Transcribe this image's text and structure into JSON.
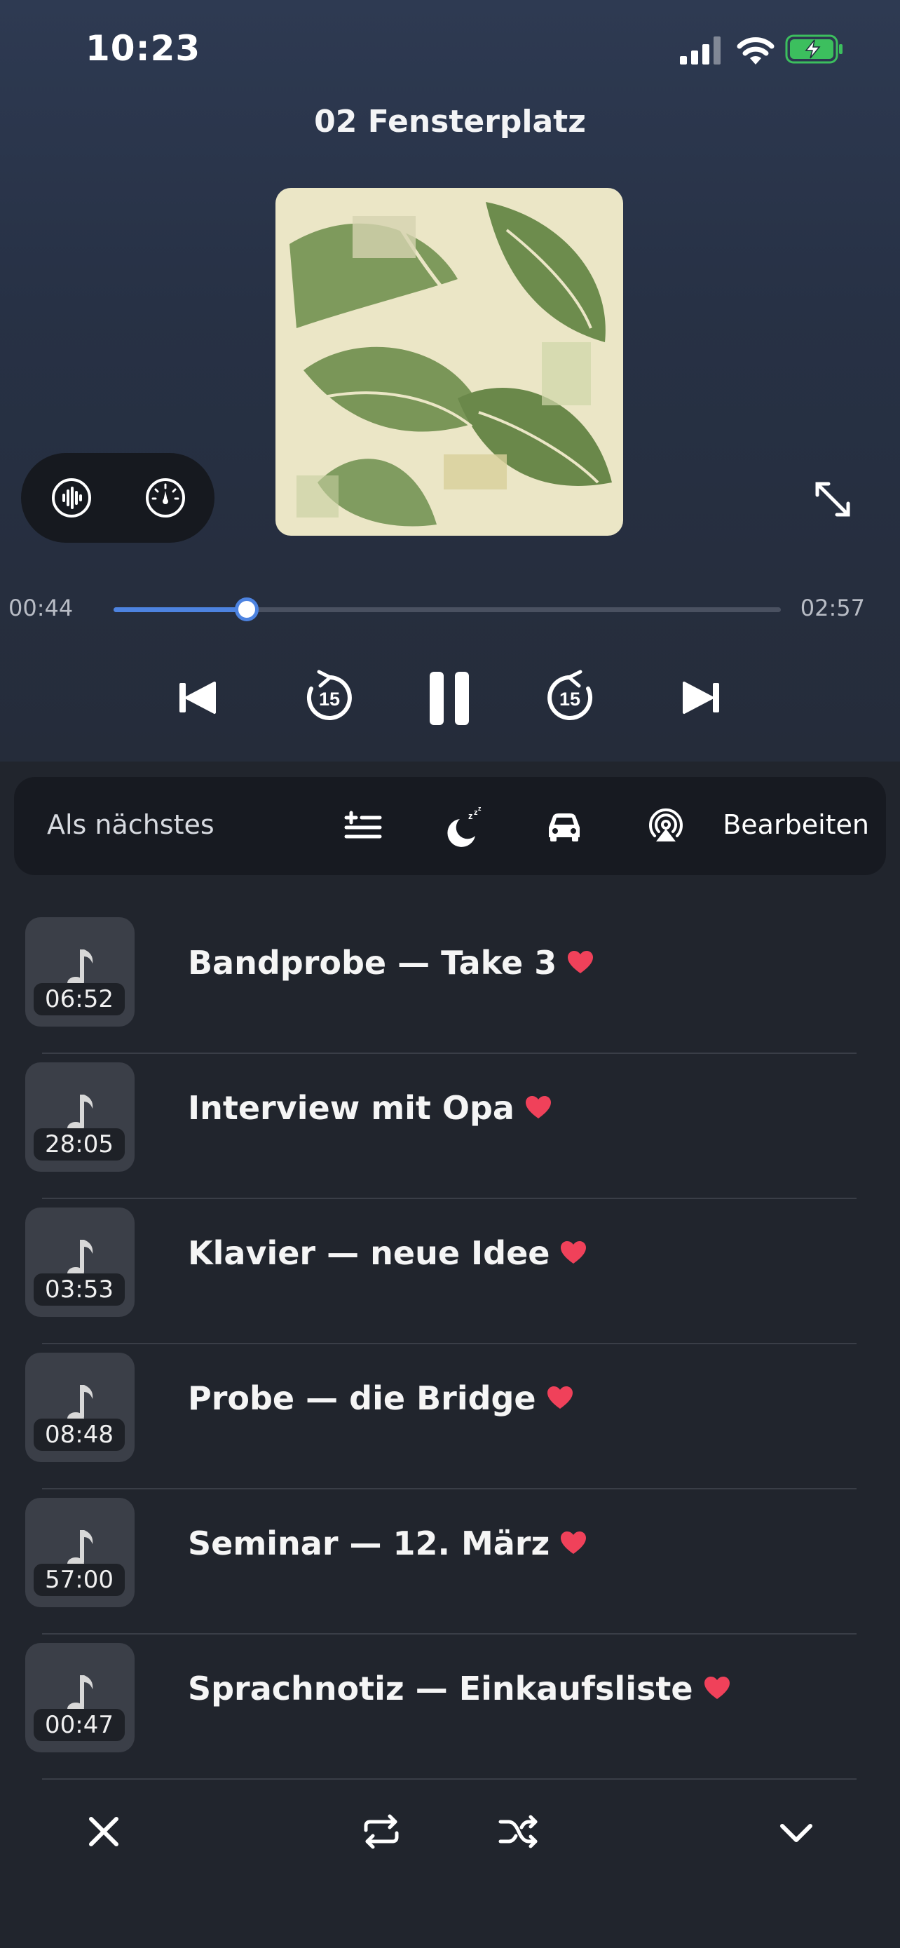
{
  "status": {
    "time": "10:23"
  },
  "player": {
    "title": "02 Fensterplatz",
    "elapsed": "00:44",
    "total": "02:57",
    "progress": 0.2
  },
  "queue": {
    "label": "Als nächstes",
    "edit_label": "Bearbeiten"
  },
  "tracks": [
    {
      "title": "Bandprobe — Take 3",
      "duration": "06:52",
      "favorite": true
    },
    {
      "title": "Interview mit Opa",
      "duration": "28:05",
      "favorite": true
    },
    {
      "title": "Klavier — neue Idee",
      "duration": "03:53",
      "favorite": true
    },
    {
      "title": "Probe — die Bridge",
      "duration": "08:48",
      "favorite": true
    },
    {
      "title": "Seminar — 12. März",
      "duration": "57:00",
      "favorite": true
    },
    {
      "title": "Sprachnotiz — Einkaufsliste",
      "duration": "00:47",
      "favorite": true
    }
  ],
  "colors": {
    "accent": "#4d83e0",
    "heart": "#f0415a",
    "background": "#21252d"
  },
  "icons": {
    "status": [
      "cellular-signal-icon",
      "wifi-icon",
      "battery-charging-icon"
    ],
    "pill": [
      "waveform-icon",
      "speedometer-icon"
    ],
    "transport": [
      "previous-track-icon",
      "rewind-15-icon",
      "pause-icon",
      "forward-15-icon",
      "next-track-icon"
    ],
    "queue": [
      "add-to-queue-icon",
      "sleep-timer-icon",
      "car-mode-icon",
      "airplay-icon"
    ],
    "bottom": [
      "close-icon",
      "repeat-icon",
      "shuffle-icon",
      "chevron-down-icon"
    ]
  }
}
